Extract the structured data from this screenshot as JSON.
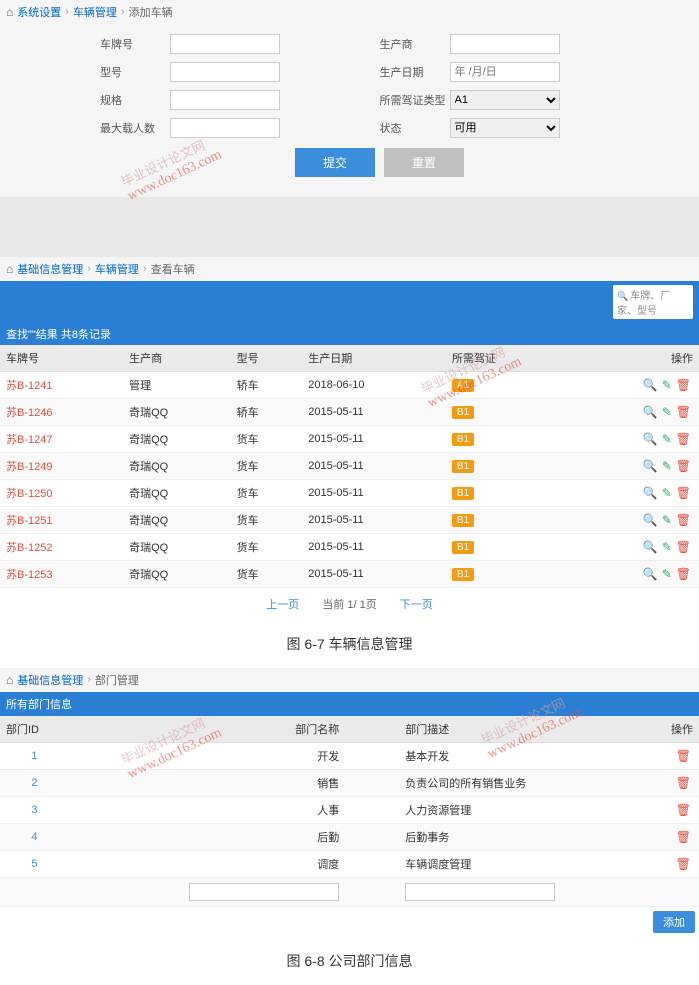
{
  "breadcrumb1": {
    "home": "系统设置",
    "middle": "车辆管理",
    "current": "添加车辆"
  },
  "form": {
    "plate": "车牌号",
    "manufacturer": "生产商",
    "type": "型号",
    "productionDate": "生产日期",
    "datePlaceholder": "年 /月/日",
    "spec": "规格",
    "licenseType": "所需驾证类型",
    "licenseDefault": "A1",
    "maxPassengers": "最大载人数",
    "status": "状态",
    "statusDefault": "可用",
    "submit": "提交",
    "reset": "重置"
  },
  "breadcrumb2": {
    "home": "基础信息管理",
    "middle": "车辆管理",
    "current": "查看车辆"
  },
  "searchPlaceholder": "车牌、厂家、型号",
  "resultHeader": "查找\"\"结果 共8条记录",
  "vehicleHeaders": {
    "plate": "车牌号",
    "manu": "生产商",
    "type": "型号",
    "date": "生产日期",
    "license": "所需驾证",
    "ops": "操作"
  },
  "vehicles": [
    {
      "plate": "苏B-1241",
      "manu": "管理",
      "type": "轿车",
      "date": "2018-06-10",
      "license": "A1"
    },
    {
      "plate": "苏B-1246",
      "manu": "奇瑞QQ",
      "type": "轿车",
      "date": "2015-05-11",
      "license": "B1"
    },
    {
      "plate": "苏B-1247",
      "manu": "奇瑞QQ",
      "type": "货车",
      "date": "2015-05-11",
      "license": "B1"
    },
    {
      "plate": "苏B-1249",
      "manu": "奇瑞QQ",
      "type": "货车",
      "date": "2015-05-11",
      "license": "B1"
    },
    {
      "plate": "苏B-1250",
      "manu": "奇瑞QQ",
      "type": "货车",
      "date": "2015-05-11",
      "license": "B1"
    },
    {
      "plate": "苏B-1251",
      "manu": "奇瑞QQ",
      "type": "货车",
      "date": "2015-05-11",
      "license": "B1"
    },
    {
      "plate": "苏B-1252",
      "manu": "奇瑞QQ",
      "type": "货车",
      "date": "2015-05-11",
      "license": "B1"
    },
    {
      "plate": "苏B-1253",
      "manu": "奇瑞QQ",
      "type": "货车",
      "date": "2015-05-11",
      "license": "B1"
    }
  ],
  "pagination": {
    "prev": "上一页",
    "info": "当前 1/ 1页",
    "next": "下一页"
  },
  "caption1": "图 6-7 车辆信息管理",
  "breadcrumb3": {
    "home": "基础信息管理",
    "current": "部门管理"
  },
  "deptHeader": "所有部门信息",
  "deptColumns": {
    "id": "部门ID",
    "name": "部门名称",
    "desc": "部门描述",
    "ops": "操作"
  },
  "departments": [
    {
      "id": "1",
      "name": "开发",
      "desc": "基本开发"
    },
    {
      "id": "2",
      "name": "销售",
      "desc": "负责公司的所有销售业务"
    },
    {
      "id": "3",
      "name": "人事",
      "desc": "人力资源管理"
    },
    {
      "id": "4",
      "name": "后勤",
      "desc": "后勤事务"
    },
    {
      "id": "5",
      "name": "调度",
      "desc": "车辆调度管理"
    }
  ],
  "addBtn": "添加",
  "caption2": "图 6-8 公司部门信息",
  "watermark": {
    "url": "www.doc163.com",
    "zh": "毕业设计论文网"
  }
}
